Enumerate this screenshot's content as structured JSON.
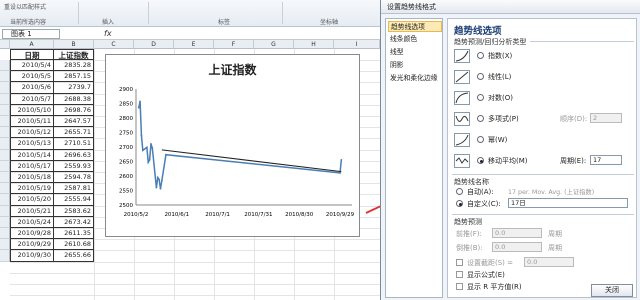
{
  "ribbon": {
    "group1": "重设以匹配样式",
    "group2": "当前所选内容",
    "group3": "插入",
    "group4": "标签",
    "group5": "坐标轴"
  },
  "formula_bar": {
    "name_box": "图表 1",
    "fx": "fx"
  },
  "sheet": {
    "columns": [
      "A",
      "B",
      "C",
      "D",
      "E",
      "F",
      "G",
      "H",
      "I"
    ],
    "header_date": "日期",
    "header_index": "上证指数",
    "rows": [
      {
        "date": "2010/5/4",
        "value": "2835.28"
      },
      {
        "date": "2010/5/5",
        "value": "2857.15"
      },
      {
        "date": "2010/5/6",
        "value": "2739.7"
      },
      {
        "date": "2010/5/7",
        "value": "2688.38"
      },
      {
        "date": "2010/5/10",
        "value": "2698.76"
      },
      {
        "date": "2010/5/11",
        "value": "2647.57"
      },
      {
        "date": "2010/5/12",
        "value": "2655.71"
      },
      {
        "date": "2010/5/13",
        "value": "2710.51"
      },
      {
        "date": "2010/5/14",
        "value": "2696.63"
      },
      {
        "date": "2010/5/17",
        "value": "2559.93"
      },
      {
        "date": "2010/5/18",
        "value": "2594.78"
      },
      {
        "date": "2010/5/19",
        "value": "2587.81"
      },
      {
        "date": "2010/5/20",
        "value": "2555.94"
      },
      {
        "date": "2010/5/21",
        "value": "2583.62"
      },
      {
        "date": "2010/5/24",
        "value": "2673.42"
      },
      {
        "date": "2010/9/28",
        "value": "2611.35"
      },
      {
        "date": "2010/9/29",
        "value": "2610.68"
      },
      {
        "date": "2010/9/30",
        "value": "2655.66"
      }
    ]
  },
  "chart_data": {
    "type": "line",
    "title": "上证指数",
    "ylim": [
      2500,
      2900
    ],
    "yticks": [
      "2500",
      "2550",
      "2600",
      "2650",
      "2700",
      "2750",
      "2800",
      "2850",
      "2900"
    ],
    "xticks": [
      "2010/5/2",
      "2010/6/1",
      "2010/7/1",
      "2010/7/31",
      "2010/8/30",
      "2010/9/29"
    ],
    "series": [
      {
        "values": [
          {
            "x": "2010/5/4",
            "y": 2835.28
          },
          {
            "x": "2010/5/5",
            "y": 2857.15
          },
          {
            "x": "2010/5/6",
            "y": 2739.7
          },
          {
            "x": "2010/5/7",
            "y": 2688.38
          },
          {
            "x": "2010/5/10",
            "y": 2698.76
          },
          {
            "x": "2010/5/11",
            "y": 2647.57
          },
          {
            "x": "2010/5/12",
            "y": 2655.71
          },
          {
            "x": "2010/5/13",
            "y": 2710.51
          },
          {
            "x": "2010/5/14",
            "y": 2696.63
          },
          {
            "x": "2010/5/17",
            "y": 2559.93
          },
          {
            "x": "2010/5/18",
            "y": 2594.78
          },
          {
            "x": "2010/5/19",
            "y": 2587.81
          },
          {
            "x": "2010/5/20",
            "y": 2555.94
          },
          {
            "x": "2010/5/21",
            "y": 2583.62
          },
          {
            "x": "2010/5/24",
            "y": 2673.42
          },
          {
            "x": "2010/9/28",
            "y": 2611.35
          },
          {
            "x": "2010/9/29",
            "y": 2610.68
          },
          {
            "x": "2010/9/30",
            "y": 2655.66
          }
        ]
      },
      {
        "values": [
          {
            "x": "2010/5/21",
            "y": 2690
          },
          {
            "x": "2010/9/30",
            "y": 2615
          }
        ]
      }
    ],
    "grid": false
  },
  "colors": {
    "series": "#4a7eb5",
    "trendline": "#222222",
    "arrow": "#e03030",
    "selected_nav": "#fde9b3"
  },
  "dialog": {
    "title": "设置趋势线格式",
    "nav": [
      "趋势线选项",
      "线条颜色",
      "线型",
      "阴影",
      "发光和柔化边缘"
    ],
    "panel_heading": "趋势线选项",
    "type_group": "趋势预测/回归分析类型",
    "types": [
      {
        "label": "指数(X)",
        "icon": "exponential-icon"
      },
      {
        "label": "线性(L)",
        "icon": "linear-icon"
      },
      {
        "label": "对数(O)",
        "icon": "logarithmic-icon"
      },
      {
        "label": "多项式(P)",
        "icon": "polynomial-icon"
      },
      {
        "label": "幂(W)",
        "icon": "power-icon"
      },
      {
        "label": "移动平均(M)",
        "icon": "moving-average-icon"
      }
    ],
    "order_label": "顺序(D):",
    "order_value": "2",
    "period_label": "周期(E):",
    "period_value": "17",
    "name_group": "趋势线名称",
    "auto_label": "自动(A):",
    "auto_value": "17 per. Mov. Avg. (上证指数)",
    "custom_label": "自定义(C):",
    "custom_value": "17日",
    "forecast_group": "趋势预测",
    "forward_label": "前推(F):",
    "forward_value": "0.0",
    "backward_label": "倒推(B):",
    "backward_value": "0.0",
    "period_unit": "周期",
    "intercept_label": "设置截距(S) =",
    "intercept_value": "0.0",
    "show_equation": "显示公式(E)",
    "show_r2": "显示 R 平方值(R)",
    "close": "关闭",
    "selected_type": "移动平均(M)",
    "selected_name_option": "自定义(C):"
  }
}
